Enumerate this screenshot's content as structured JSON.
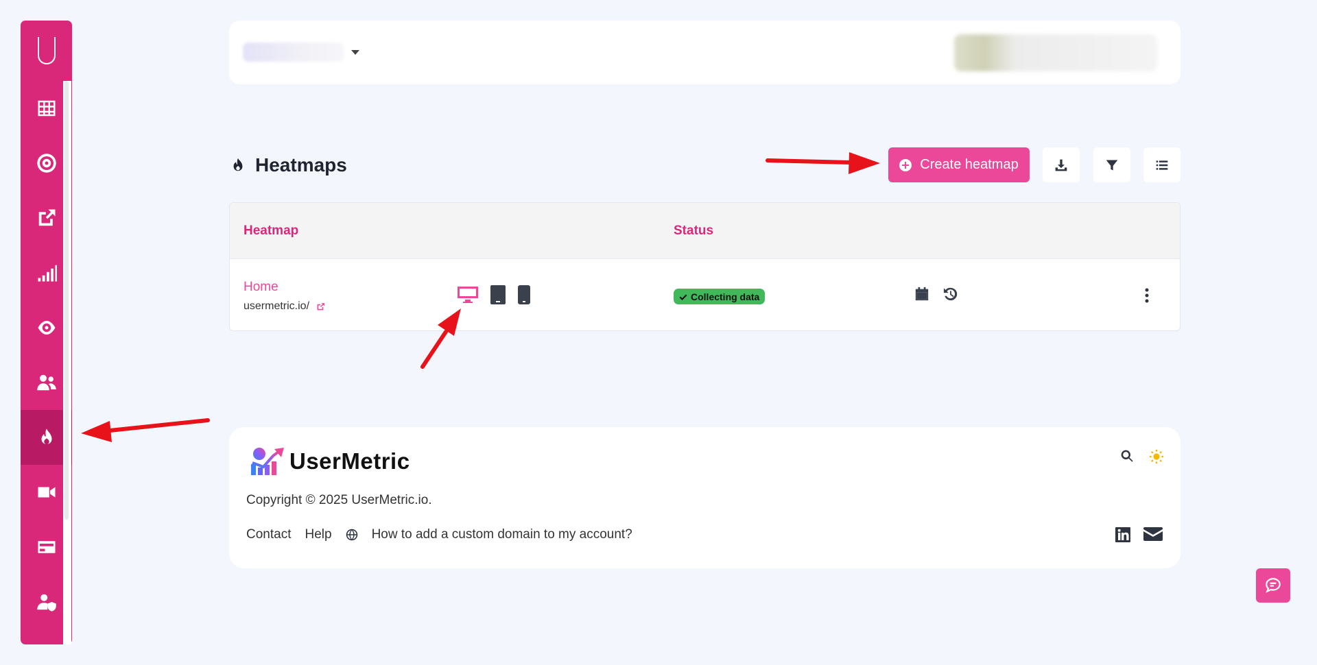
{
  "sidebar": {
    "logo_icon": "usermetric-u-logo",
    "items": [
      {
        "name": "dashboard-grid-icon"
      },
      {
        "name": "goals-target-icon"
      },
      {
        "name": "external-link-icon"
      },
      {
        "name": "signal-bars-icon"
      },
      {
        "name": "eye-icon"
      },
      {
        "name": "users-icon"
      },
      {
        "name": "heatmap-flame-icon",
        "active": true
      },
      {
        "name": "video-camera-icon"
      },
      {
        "name": "billing-card-icon"
      },
      {
        "name": "user-shield-icon"
      }
    ]
  },
  "header": {
    "title": "Heatmaps",
    "create_label": "Create heatmap"
  },
  "table": {
    "col_heatmap": "Heatmap",
    "col_status": "Status",
    "rows": [
      {
        "name": "Home",
        "url": "usermetric.io/",
        "status": "Collecting data",
        "active_device": "desktop"
      }
    ]
  },
  "footer": {
    "brand": "UserMetric",
    "copyright": "Copyright © 2025 UserMetric.io.",
    "links": {
      "contact": "Contact",
      "help": "Help",
      "custom_domain": "How to add a custom domain to my account?"
    }
  },
  "colors": {
    "brand": "#d9277a",
    "accent": "#ec4899",
    "status_green": "#41b95b",
    "theme_sun": "#f5b800"
  }
}
